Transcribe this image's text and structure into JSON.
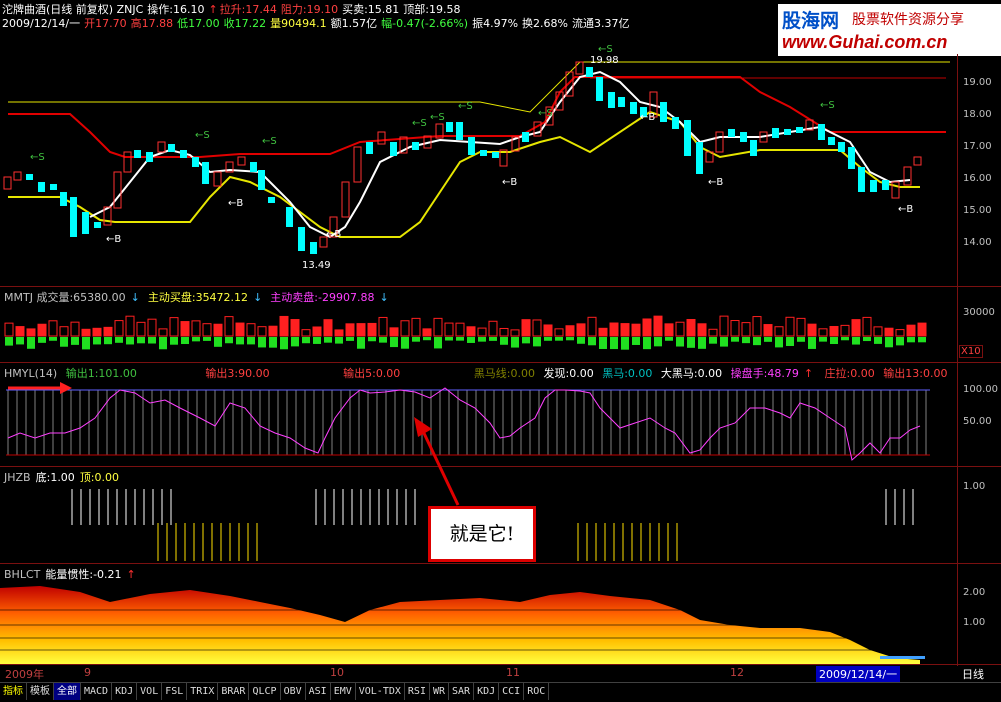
{
  "header": {
    "line1": {
      "title": "沱牌曲酒(日线 前复权) ZNJC",
      "op": "操作:16.10",
      "lashen": "拉升:17.44",
      "zuli": "阻力:19.10",
      "maimai": "买卖:15.81",
      "dingbu": "顶部:19.58"
    },
    "line2": {
      "date": "2009/12/14/一",
      "open": "开17.70",
      "high": "高17.88",
      "low": "低17.00",
      "close": "收17.22",
      "vol": "量90494.1",
      "amount": "额1.57亿",
      "change": "幅-0.47(-2.66%)",
      "amplitude": "振4.97%",
      "turnover": "换2.68%",
      "float": "流通3.37亿"
    }
  },
  "logo": {
    "cn": "股海网",
    "slogan": "股票软件资源分享",
    "url": "www.Guhai.com.cn"
  },
  "price_axis": [
    "19.00",
    "18.00",
    "17.00",
    "16.00",
    "15.00",
    "14.00"
  ],
  "annotations": {
    "high": "19.98",
    "low": "13.49",
    "sell_marks": [
      "←S",
      "←S",
      "←S",
      "←S",
      "←S",
      "←S",
      "←S",
      "←S",
      "←S"
    ],
    "buy_marks": [
      "←B",
      "←B",
      "←B",
      "←B",
      "←B",
      "←B",
      "←B"
    ]
  },
  "mmtj": {
    "name": "MMTJ 成交量:65380.00",
    "active_buy": "主动买盘:35472.12",
    "active_sell": "主动卖盘:-29907.88",
    "axis": "30000",
    "unit": "X10"
  },
  "hmyl": {
    "name": "HMYL(14)",
    "items": [
      {
        "label": "输出1:101.00",
        "color": "#40c040"
      },
      {
        "label": "输出3:90.00",
        "color": "#ff4040"
      },
      {
        "label": "输出5:0.00",
        "color": "#ff4040"
      },
      {
        "label": "黑马线:0.00",
        "color": "#808000"
      },
      {
        "label": "发现:0.00",
        "color": "#ffffff"
      },
      {
        "label": "黑马:0.00",
        "color": "#00c0c0"
      },
      {
        "label": "大黑马:0.00",
        "color": "#ffffff"
      },
      {
        "label": "操盘手:48.79",
        "color": "#ff40ff"
      },
      {
        "label": "庄拉:0.00",
        "color": "#ff4040"
      },
      {
        "label": "输出13:0.00",
        "color": "#ff4040"
      }
    ],
    "axis": [
      "100.00",
      "50.00"
    ]
  },
  "jhzb": {
    "name": "JHZB",
    "bottom": "底:1.00",
    "top": "顶:0.00",
    "axis": "1.00"
  },
  "bhlct": {
    "name": "BHLCT",
    "label": "能量惯性:-0.21",
    "axis": [
      "2.00",
      "1.00"
    ]
  },
  "x_axis": [
    "2009年",
    "9",
    "10",
    "11",
    "12"
  ],
  "cursor_date": "2009/12/14/一",
  "period": "日线",
  "callout": "就是它!",
  "tabs": [
    "指标",
    "模板",
    "全部",
    "MACD",
    "KDJ",
    "VOL",
    "FSL",
    "TRIX",
    "BRAR",
    "QLCP",
    "OBV",
    "ASI",
    "EMV",
    "VOL-TDX",
    "RSI",
    "WR",
    "SAR",
    "KDJ",
    "CCI",
    "ROC"
  ]
}
